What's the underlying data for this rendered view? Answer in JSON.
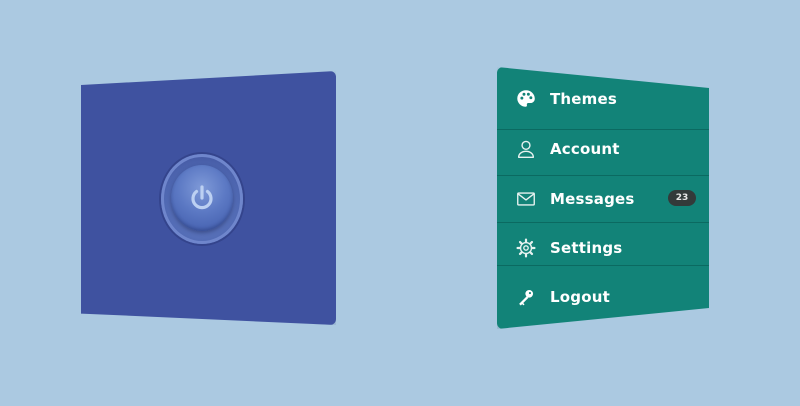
{
  "menu": {
    "items": [
      {
        "label": "Themes",
        "icon": "palette-icon"
      },
      {
        "label": "Account",
        "icon": "user-icon"
      },
      {
        "label": "Messages",
        "icon": "envelope-icon",
        "badge": "23"
      },
      {
        "label": "Settings",
        "icon": "gear-icon"
      },
      {
        "label": "Logout",
        "icon": "key-icon"
      }
    ]
  },
  "power": {
    "icon": "power-icon"
  },
  "colors": {
    "background": "#abc9e1",
    "power_panel": "#3f52a0",
    "menu_panel": "#128378",
    "badge": "#333a3a"
  }
}
